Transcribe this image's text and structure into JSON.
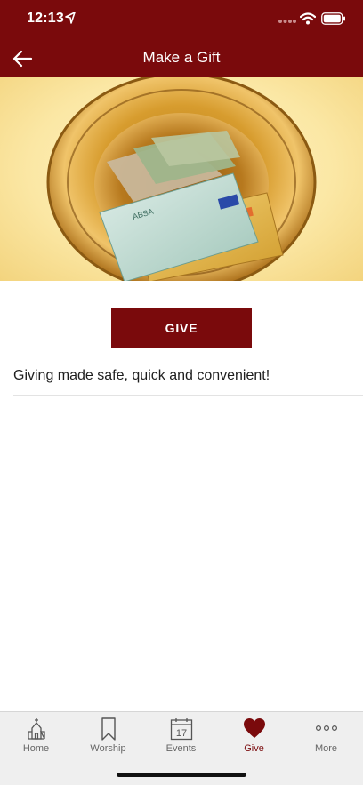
{
  "status_bar": {
    "time": "12:13"
  },
  "nav": {
    "title": "Make a Gift",
    "back_icon": "arrow-left-icon"
  },
  "hero": {
    "image": "collection-plate-with-money-and-credit-cards"
  },
  "main": {
    "give_label": "GIVE",
    "tagline": "Giving made safe, quick and convenient!"
  },
  "tab_bar": {
    "items": [
      {
        "label": "Home",
        "icon": "church-icon"
      },
      {
        "label": "Worship",
        "icon": "bookmark-icon"
      },
      {
        "label": "Events",
        "icon": "calendar-icon",
        "calendar_day": "17"
      },
      {
        "label": "Give",
        "icon": "heart-icon",
        "active": true
      },
      {
        "label": "More",
        "icon": "more-dots-icon"
      }
    ]
  },
  "colors": {
    "brand": "#7a0a0c",
    "tab_inactive": "#666666",
    "tab_bar_bg": "#efefef"
  }
}
